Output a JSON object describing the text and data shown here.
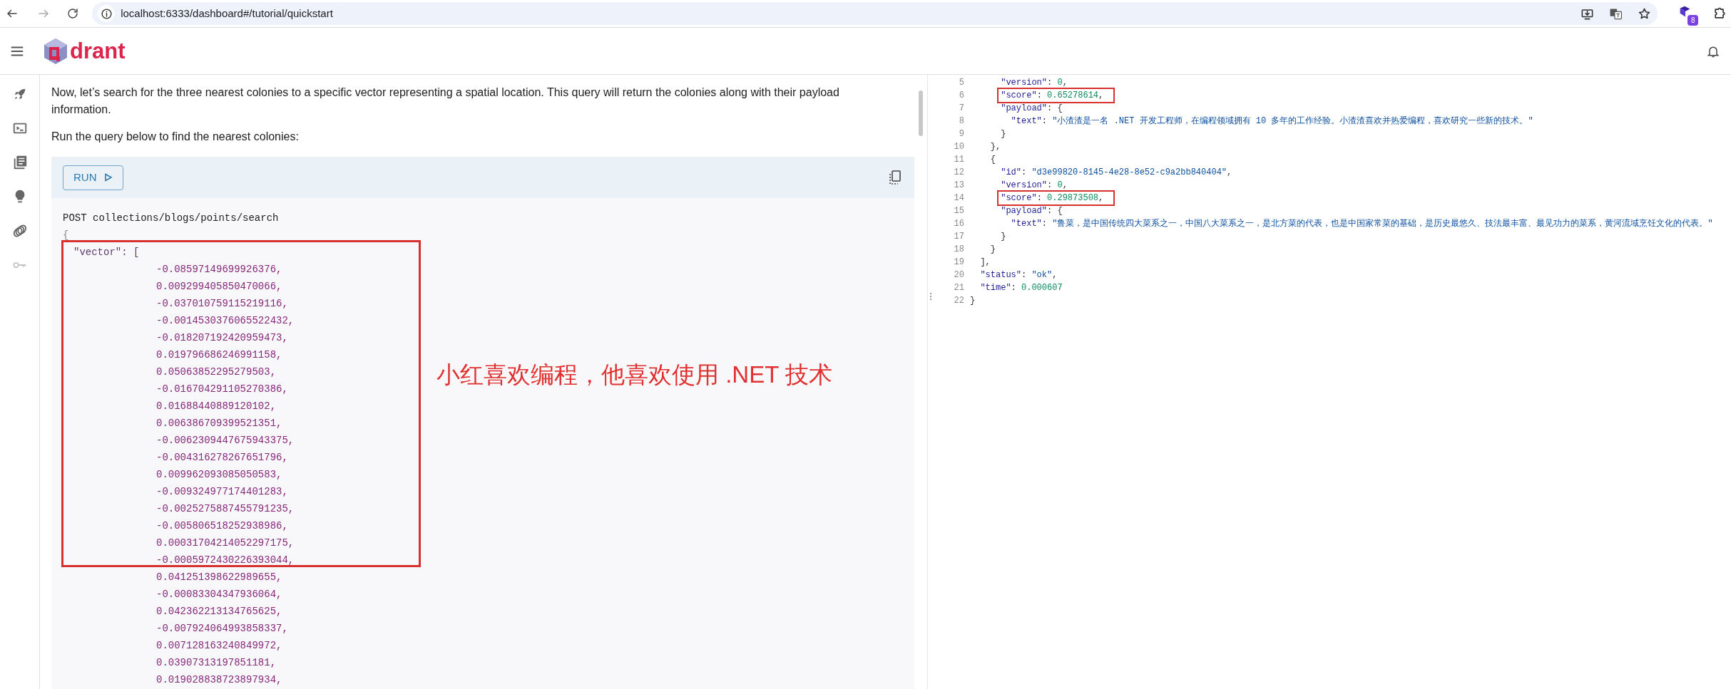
{
  "browser": {
    "url": "localhost:6333/dashboard#/tutorial/quickstart",
    "extension_badge": "8"
  },
  "app_header": {
    "logo_text": "drant"
  },
  "sidebar": {
    "items": [
      {
        "kind": "rocket",
        "disabled": false
      },
      {
        "kind": "console",
        "disabled": false
      },
      {
        "kind": "collections",
        "disabled": false
      },
      {
        "kind": "tutorial",
        "disabled": false
      },
      {
        "kind": "datasets",
        "disabled": false
      },
      {
        "kind": "key",
        "disabled": true
      }
    ]
  },
  "tutorial": {
    "paragraphs": [
      "Now, let’s search for the three nearest colonies to a specific vector representing a spatial location. This query will return the colonies along with their payload information.",
      "Run the query below to find the nearest colonies:"
    ],
    "code_block": {
      "run_button": "RUN",
      "request_line": "POST collections/blogs/points/search",
      "open_brace": "{",
      "vector_key_line": "\"vector\": [",
      "values": [
        "-0.08597149699926376,",
        "0.009299405850470066,",
        "-0.037010759115219116,",
        "-0.0014530376065522432,",
        "-0.018207192420959473,",
        "0.019796686246991158,",
        "0.05063852295279503,",
        "-0.016704291105270386,",
        "0.01688440889120102,",
        "0.006386709399521351,",
        "-0.0062309447675943375,",
        "-0.004316278267651796,",
        "0.009962093085050583,",
        "-0.009324977174401283,",
        "-0.0025275887455791235,",
        "-0.005806518252938986,",
        "0.00031704214052297175,",
        "-0.0005972430226393044,",
        "0.041251398622989655,",
        "-0.00083304347936064,",
        "0.042362213134765625,",
        "-0.007924064993858337,",
        "0.007128163240849972,",
        "0.03907313197851181,",
        "0.019028838723897934,"
      ]
    }
  },
  "response_panel": {
    "lines": [
      {
        "number": "5",
        "text": "      \"version\": 0,"
      },
      {
        "number": "6",
        "text": "      \"score\": 0.65278614,"
      },
      {
        "number": "7",
        "text": "      \"payload\": {"
      },
      {
        "number": "8",
        "text": "        \"text\": \"小渣渣是一名 .NET 开发工程师，在编程领域拥有 10 多年的工作经验。小渣渣喜欢并热爱编程，喜欢研究一些新的技术。\""
      },
      {
        "number": "9",
        "text": "      }"
      },
      {
        "number": "10",
        "text": "    },"
      },
      {
        "number": "11",
        "text": "    {"
      },
      {
        "number": "12",
        "text": "      \"id\": \"d3e99820-8145-4e28-8e52-c9a2bb840404\","
      },
      {
        "number": "13",
        "text": "      \"version\": 0,"
      },
      {
        "number": "14",
        "text": "      \"score\": 0.29873508,"
      },
      {
        "number": "15",
        "text": "      \"payload\": {"
      },
      {
        "number": "16",
        "text": "        \"text\": \"鲁菜，是中国传统四大菜系之一，中国八大菜系之一，是北方菜的代表，也是中国家常菜的基础，是历史最悠久、技法最丰富、最见功力的菜系，黄河流域烹饪文化的代表。\""
      },
      {
        "number": "17",
        "text": "      }"
      },
      {
        "number": "18",
        "text": "    }"
      },
      {
        "number": "19",
        "text": "  ],"
      },
      {
        "number": "20",
        "text": "  \"status\": \"ok\","
      },
      {
        "number": "21",
        "text": "  \"time\": 0.000607"
      },
      {
        "number": "22",
        "text": "}"
      }
    ]
  },
  "annotations": {
    "note": "小红喜欢编程，他喜欢使用 .NET 技术"
  }
}
